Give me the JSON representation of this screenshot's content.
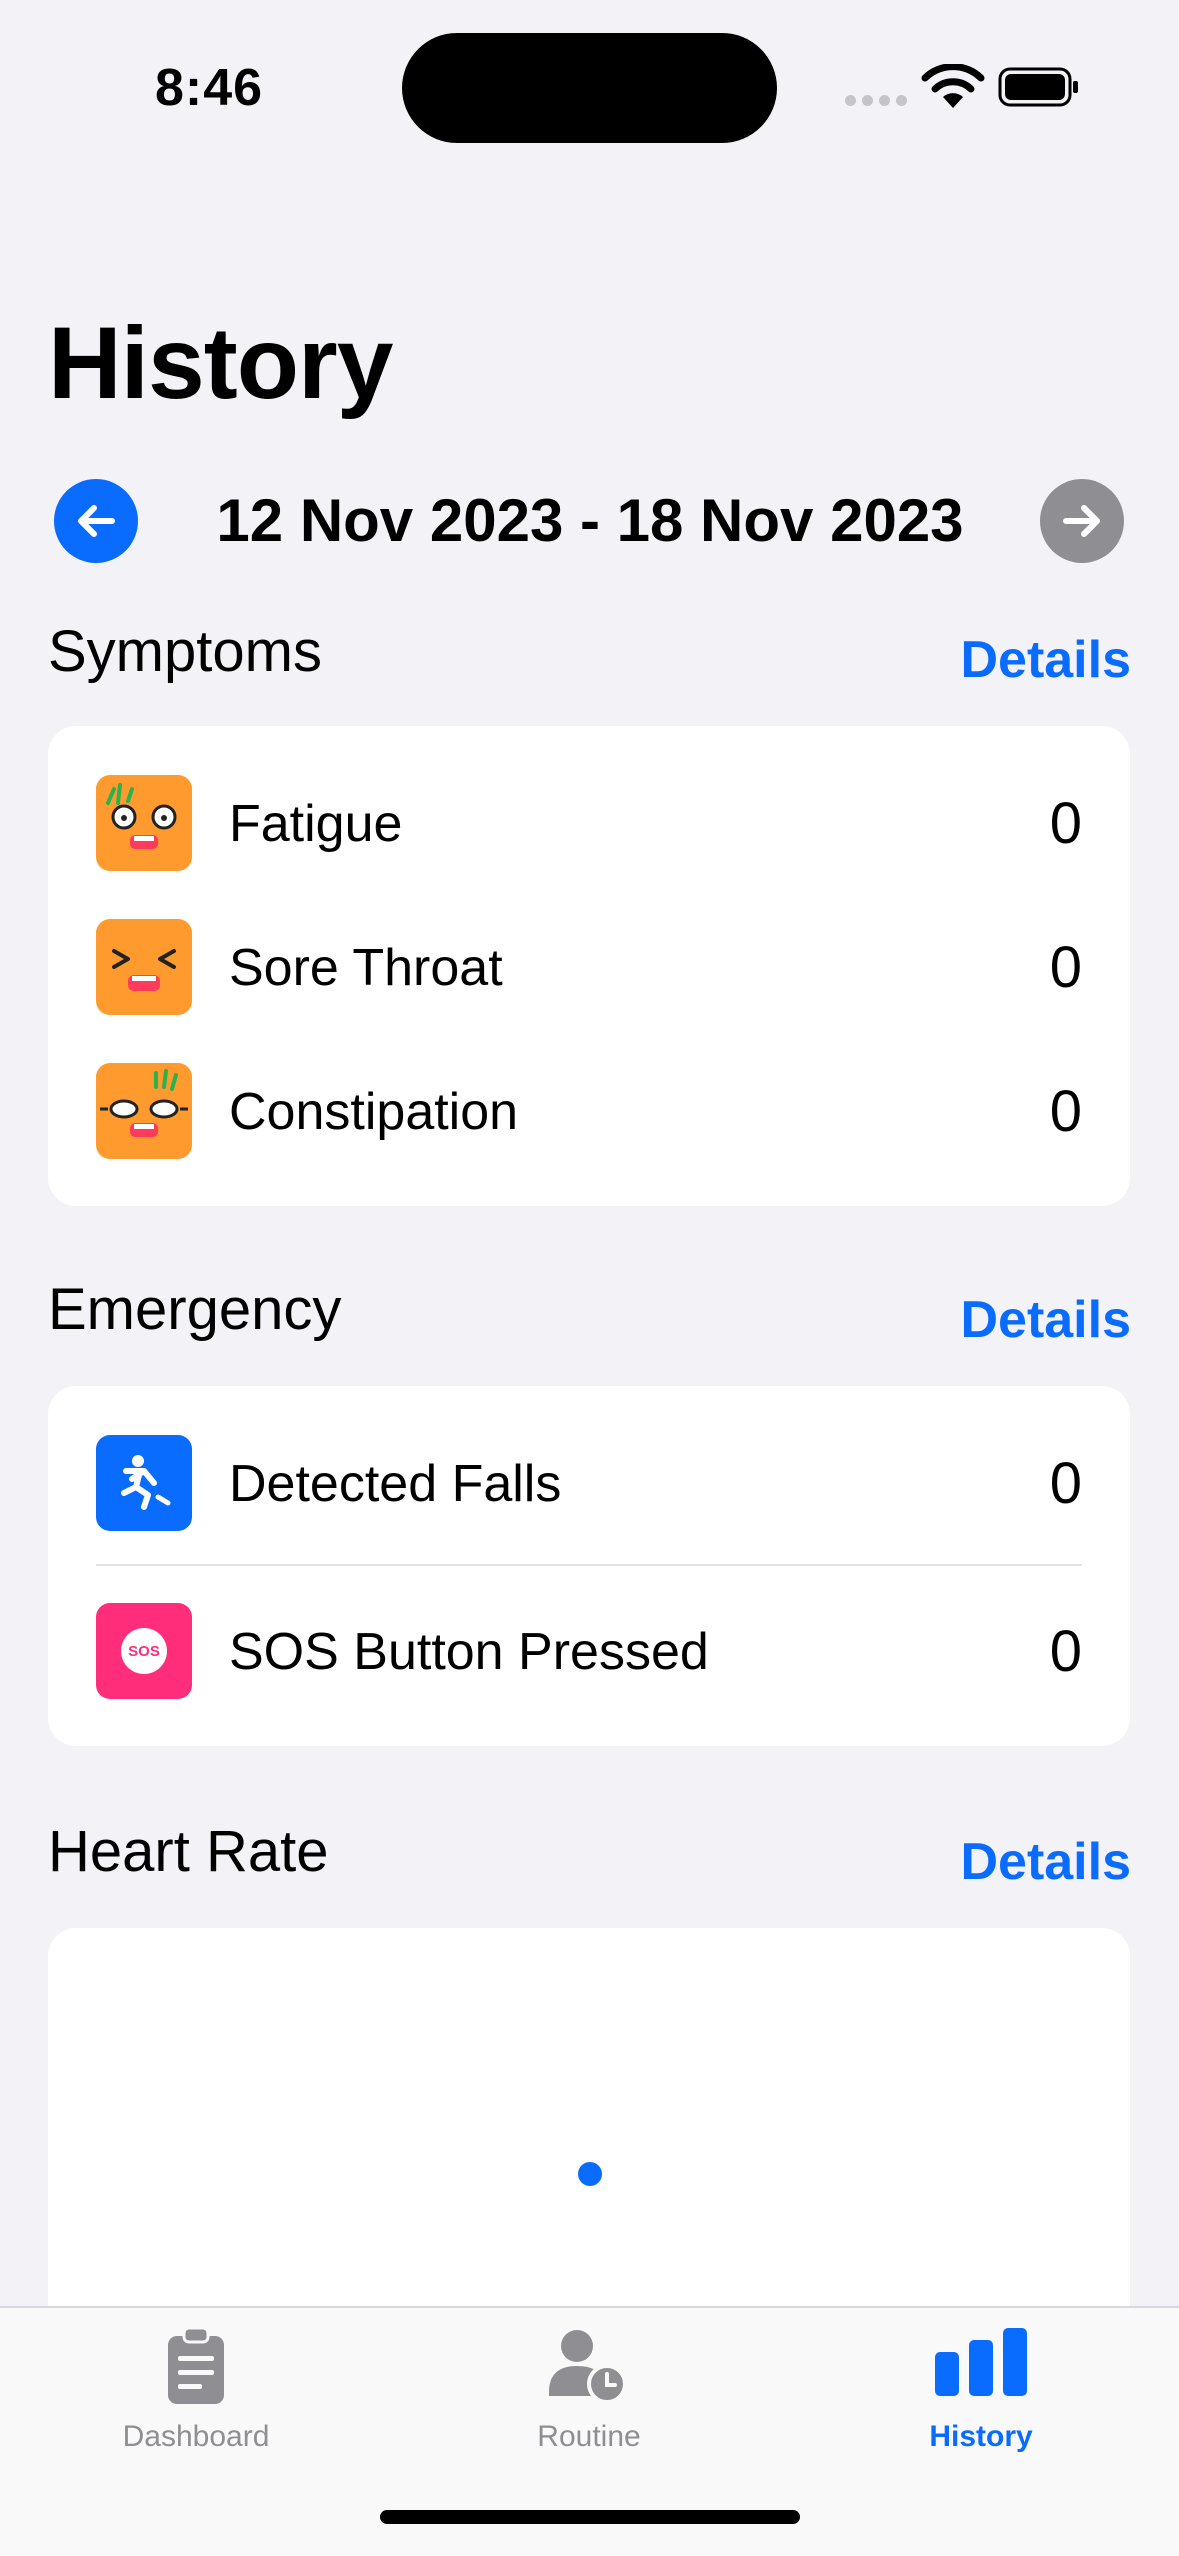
{
  "status_bar": {
    "time": "8:46"
  },
  "page": {
    "title": "History"
  },
  "date_nav": {
    "range": "12 Nov 2023 - 18 Nov 2023"
  },
  "symptoms": {
    "title": "Symptoms",
    "details_label": "Details",
    "items": [
      {
        "label": "Fatigue",
        "value": "0",
        "icon": "fatigue-face-icon"
      },
      {
        "label": "Sore Throat",
        "value": "0",
        "icon": "sore-throat-face-icon"
      },
      {
        "label": "Constipation",
        "value": "0",
        "icon": "constipation-face-icon"
      }
    ]
  },
  "emergency": {
    "title": "Emergency",
    "details_label": "Details",
    "items": [
      {
        "label": "Detected Falls",
        "value": "0",
        "icon": "fall-person-icon"
      },
      {
        "label": "SOS Button Pressed",
        "value": "0",
        "icon": "sos-icon",
        "icon_text": "SOS"
      }
    ]
  },
  "heart_rate": {
    "title": "Heart Rate",
    "details_label": "Details"
  },
  "tabs": [
    {
      "label": "Dashboard",
      "icon": "clipboard-icon",
      "active": false
    },
    {
      "label": "Routine",
      "icon": "person-clock-icon",
      "active": false
    },
    {
      "label": "History",
      "icon": "bar-chart-icon",
      "active": true
    }
  ],
  "colors": {
    "accent": "#0a6bff",
    "symptom_icon_bg": "#ff9a2e",
    "sos_bg": "#ff2d7a",
    "inactive": "#8e8e93",
    "background": "#f2f2f7"
  }
}
